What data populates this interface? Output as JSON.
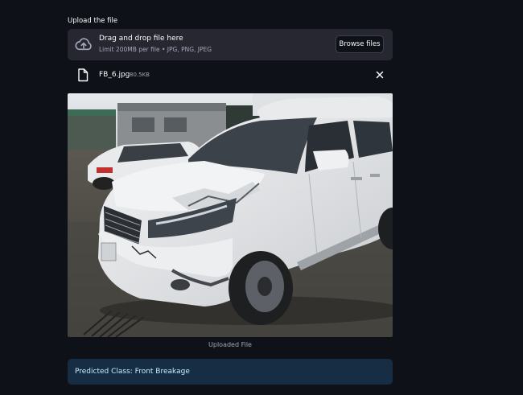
{
  "uploader": {
    "label": "Upload the file",
    "dropzone_title": "Drag and drop file here",
    "dropzone_subtitle": "Limit 200MB per file • JPG, PNG, JPEG",
    "browse_label": "Browse files",
    "upload_icon": "cloud-upload-icon"
  },
  "file": {
    "name": "FB_6.jpg",
    "size": "80.5KB",
    "file_icon": "file-icon",
    "remove_icon": "close-icon"
  },
  "image": {
    "caption": "Uploaded File"
  },
  "result": {
    "text": "Predicted Class: Front Breakage"
  },
  "colors": {
    "background": "#0e1117",
    "widget": "#262730",
    "info_bg": "#172d43",
    "info_text": "#c7ebff"
  }
}
